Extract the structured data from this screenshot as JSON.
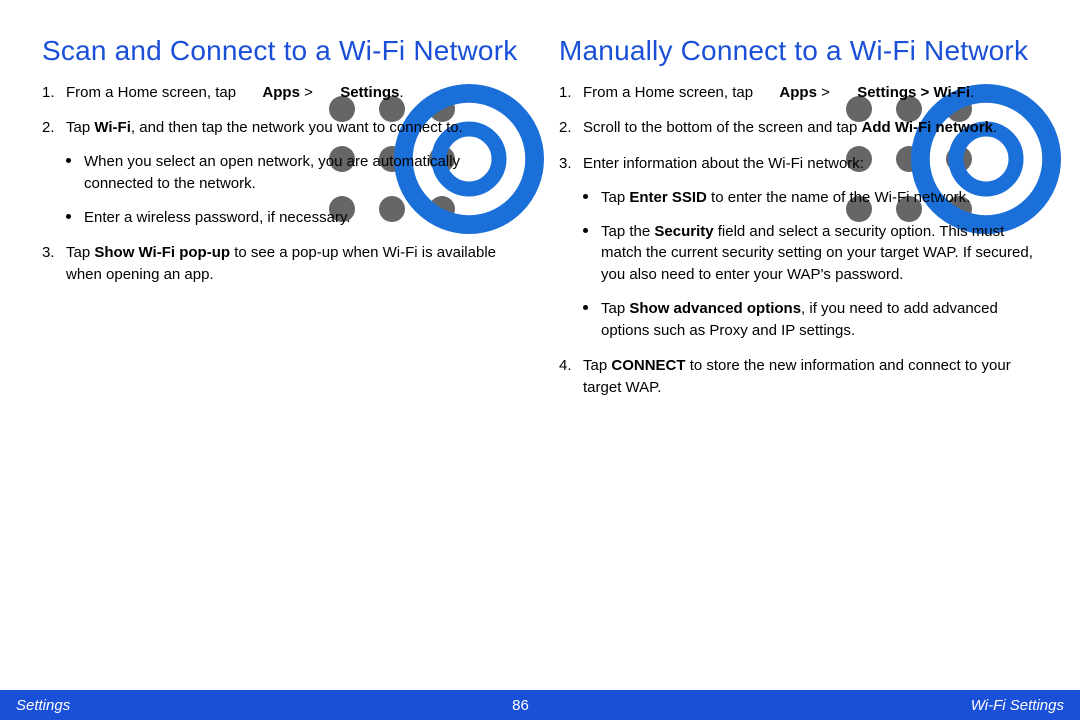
{
  "left": {
    "heading": "Scan and Connect to a Wi-Fi Network",
    "s1a": "From a Home screen, tap ",
    "apps": "Apps",
    "sep": " > ",
    "settings": "Settings",
    "s1b": ".",
    "s2a": "Tap ",
    "wifi": "Wi-Fi",
    "s2b": ", and then tap the network you want to connect to.",
    "b1": "When you select an open network, you are automatically connected to the network.",
    "b2": "Enter a wireless password, if necessary.",
    "s3a": "Tap ",
    "popup": "Show Wi-Fi pop-up",
    "s3b": " to see a pop-up when Wi-Fi is available when opening an app."
  },
  "right": {
    "heading": "Manually Connect to a Wi-Fi Network",
    "s1a": "From a Home screen, tap ",
    "apps": "Apps",
    "sep": " > ",
    "settings": "Settings",
    "sep2": " > ",
    "wifi": "Wi-Fi",
    "s1b": ".",
    "s2a": "Scroll to the bottom of the screen and tap ",
    "addnet": "Add Wi-Fi network",
    "s2b": ".",
    "s3": "Enter information about the Wi-Fi network:",
    "b1a": "Tap ",
    "ssid": "Enter SSID",
    "b1b": " to enter the name of the Wi-Fi network.",
    "b2a": "Tap the ",
    "sec": "Security",
    "b2b": " field and select a security option. This must match the current security setting on your target WAP. If secured, you also need to enter your WAP's password.",
    "b3a": "Tap ",
    "adv": "Show advanced options",
    "b3b": ", if you need to add advanced options such as Proxy and IP settings.",
    "s4a": "Tap ",
    "connect": "CONNECT",
    "s4b": " to store the new information and connect to your target WAP."
  },
  "footer": {
    "left": "Settings",
    "center": "86",
    "right": "Wi-Fi Settings"
  }
}
